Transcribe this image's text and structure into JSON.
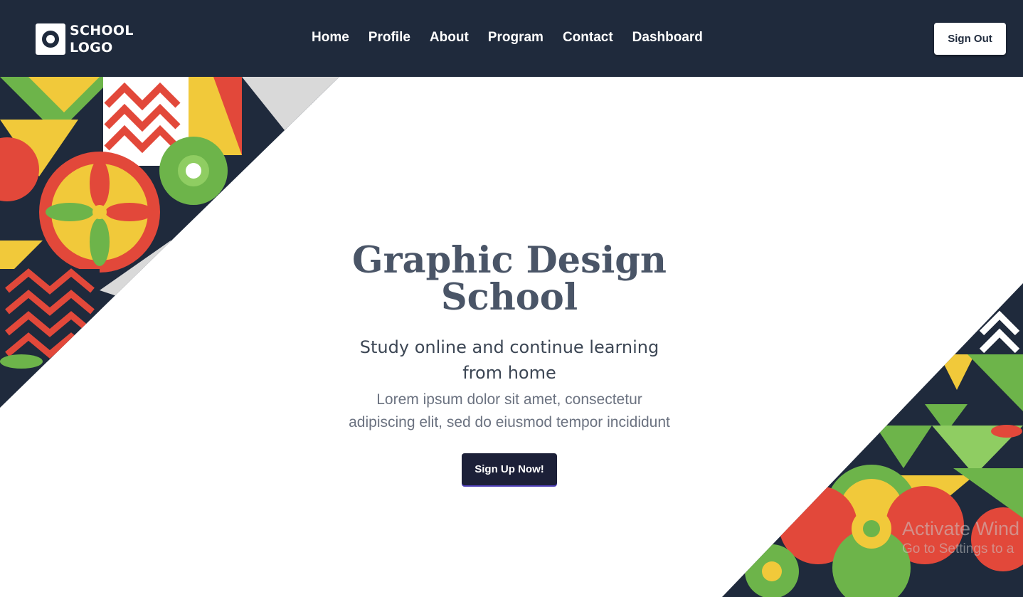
{
  "logo": {
    "line1": "SCHOOL",
    "line2": "LOGO"
  },
  "nav": {
    "links": [
      "Home",
      "Profile",
      "About",
      "Program",
      "Contact",
      "Dashboard"
    ],
    "signout_label": "Sign Out"
  },
  "hero": {
    "title_line1": "Graphic Design",
    "title_line2": "School",
    "subtitle": "Study online and continue learning from home",
    "description": "Lorem ipsum dolor sit amet, consectetur adipiscing elit, sed do eiusmod tempor incididunt",
    "cta_label": "Sign Up Now!"
  },
  "watermark": {
    "line1": "Activate Wind",
    "line2": "Go to Settings to a"
  },
  "colors": {
    "navbar": "#1f2a3c",
    "cta": "#1c2038",
    "pattern_red": "#e2483a",
    "pattern_green": "#6db44a",
    "pattern_yellow": "#f1c93a"
  }
}
